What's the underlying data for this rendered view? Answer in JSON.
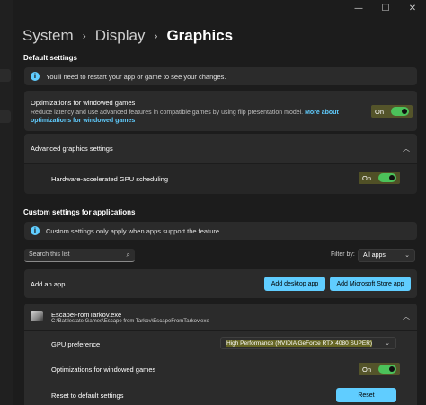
{
  "window": {
    "controls": {
      "minimize": "—",
      "maximize": "☐",
      "close": "✕"
    }
  },
  "breadcrumb": {
    "items": [
      "System",
      "Display",
      "Graphics"
    ],
    "separator": "›"
  },
  "default_settings": {
    "heading": "Default settings",
    "info": "You'll need to restart your app or game to see your changes.",
    "windowed_opt": {
      "title": "Optimizations for windowed games",
      "desc": "Reduce latency and use advanced features in compatible games by using flip presentation model.",
      "link": "More about optimizations for windowed games",
      "state": "On"
    },
    "advanced": {
      "title": "Advanced graphics settings",
      "hags": {
        "title": "Hardware-accelerated GPU scheduling",
        "state": "On"
      }
    }
  },
  "custom_settings": {
    "heading": "Custom settings for applications",
    "info": "Custom settings only apply when apps support the feature.",
    "search_placeholder": "Search this list",
    "filter_label": "Filter by:",
    "filter_value": "All apps",
    "add_app": {
      "label": "Add an app",
      "desktop_button": "Add desktop app",
      "store_button": "Add Microsoft Store app"
    },
    "app": {
      "name": "EscapeFromTarkov.exe",
      "path": "C:\\Battlestate Games\\Escape from Tarkov\\EscapeFromTarkov.exe",
      "gpu_pref_label": "GPU preference",
      "gpu_pref_value": "High Performance (NVIDIA GeForce RTX 4080 SUPER)",
      "windowed_label": "Optimizations for windowed games",
      "windowed_state": "On",
      "reset_label": "Reset to default settings",
      "reset_button": "Reset"
    }
  },
  "colors": {
    "accent": "#60cdff",
    "toggle_on": "#4cc25a",
    "background": "#1c1c1c",
    "card": "#2b2b2b"
  },
  "icons": [
    "minimize-icon",
    "maximize-icon",
    "close-icon",
    "info-icon",
    "chevron-up-icon",
    "search-icon",
    "chevron-down-icon",
    "app-icon"
  ]
}
